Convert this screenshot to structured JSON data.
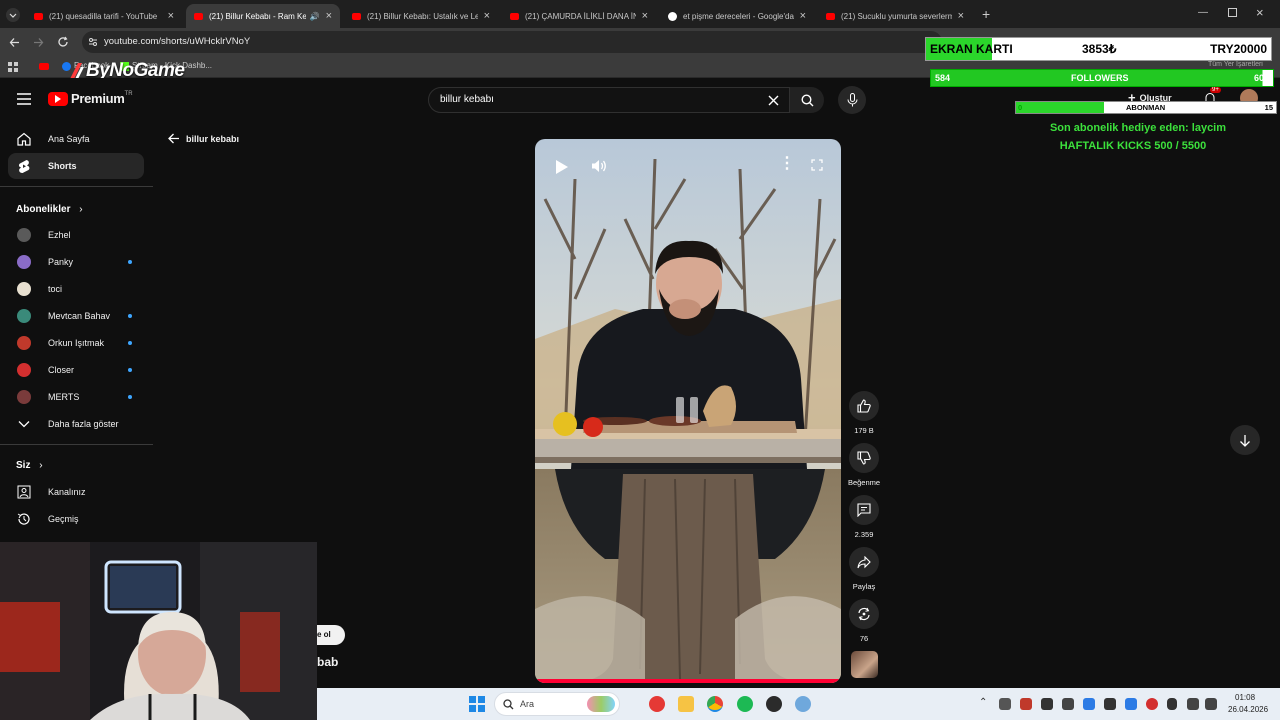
{
  "browser": {
    "tabs": [
      {
        "label": "(21) quesadilla tarifi - YouTube",
        "icon": "youtube-icon"
      },
      {
        "label": "(21) Billur Kebabı - Ram Kel",
        "icon": "youtube-icon",
        "active": true
      },
      {
        "label": "(21) Billur Kebabı: Ustalık ve Le",
        "icon": "youtube-icon"
      },
      {
        "label": "(21) ÇAMURDA İLİKLİ DANA İN",
        "icon": "youtube-icon"
      },
      {
        "label": "et pişme dereceleri - Google'da",
        "icon": "google-icon"
      },
      {
        "label": "(21) Sucuklu yumurta severlerm",
        "icon": "youtube-icon"
      }
    ],
    "new_tab": "+",
    "url": "youtube.com/shorts/uWHcklrVNoY",
    "bookmarks": [
      "Facebook",
      "Stream - Kick Dashb...",
      "Tüm Yer İşaretleri"
    ]
  },
  "overlay": {
    "brand": "ByNoGame",
    "ekran_label": "EKRAN KARTI",
    "ekran_amount": "3853₺",
    "ekran_goal": "TRY20000",
    "ekran_progress": 0.19,
    "followers_current": "584",
    "followers_label": "FOLLOWERS",
    "followers_goal": "600",
    "followers_progress": 0.97,
    "abonman_current": "0",
    "abonman_label": "ABONMAN",
    "abonman_goal": "15",
    "last_sub": "Son abonelik hediye eden: laycim",
    "weekly_kicks": "HAFTALIK KICKS 500 / 5500"
  },
  "youtube": {
    "logo_text": "Premium",
    "logo_sup": "TR",
    "search_value": "billur kebabı",
    "create_label": "Oluştur",
    "notif_badge": "9+",
    "back_label": "billur kebabı",
    "sidebar": {
      "home": "Ana Sayfa",
      "shorts": "Shorts",
      "subs_heading": "Abonelikler",
      "channels": [
        {
          "name": "Ezhel",
          "color": "#5a5a5a",
          "dot": false
        },
        {
          "name": "Panky",
          "color": "#8a6cc7",
          "dot": true
        },
        {
          "name": "toci",
          "color": "#e8e0d0",
          "dot": false
        },
        {
          "name": "Mevtcan Bahav",
          "color": "#3a8a7a",
          "dot": true
        },
        {
          "name": "Orkun Işıtmak",
          "color": "#c0392b",
          "dot": true
        },
        {
          "name": "Closer",
          "color": "#d32f2f",
          "dot": true
        },
        {
          "name": "MERTS",
          "color": "#7a3b3b",
          "dot": true
        }
      ],
      "show_more": "Daha fazla göster",
      "you_heading": "Siz",
      "your_channel": "Kanalınız",
      "history": "Geçmiş"
    },
    "actions": {
      "likes": "179 B",
      "dislike": "Beğenme",
      "comments": "2.359",
      "share": "Paylaş",
      "remix": "76"
    },
    "cutoff_subscribe": "e ol",
    "cutoff_title": "bab"
  },
  "taskbar": {
    "search_placeholder": "Ara",
    "time": "01:08",
    "date": "26.04.2026"
  }
}
